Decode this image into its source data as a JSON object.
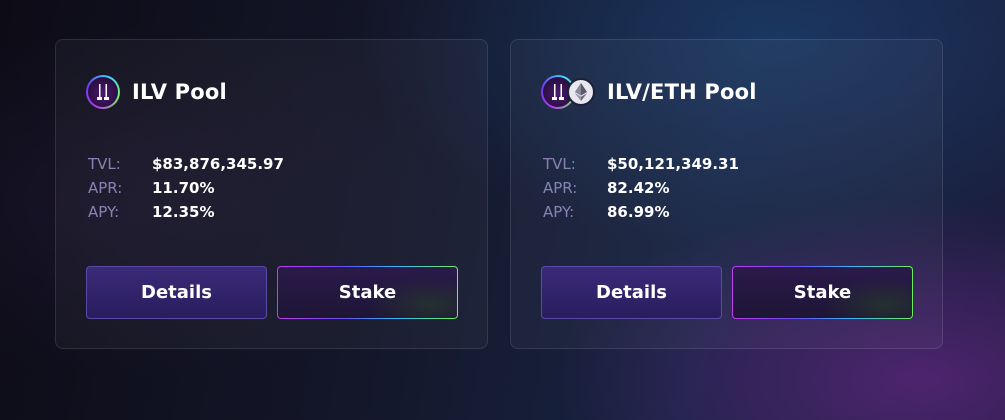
{
  "pools": [
    {
      "title": "ILV Pool",
      "icons": [
        "ilv-icon"
      ],
      "stats": {
        "tvl_label": "TVL:",
        "tvl_value": "$83,876,345.97",
        "apr_label": "APR:",
        "apr_value": "11.70%",
        "apy_label": "APY:",
        "apy_value": "12.35%"
      },
      "buttons": {
        "details_label": "Details",
        "stake_label": "Stake"
      }
    },
    {
      "title": "ILV/ETH Pool",
      "icons": [
        "ilv-icon",
        "eth-icon"
      ],
      "stats": {
        "tvl_label": "TVL:",
        "tvl_value": "$50,121,349.31",
        "apr_label": "APR:",
        "apr_value": "82.42%",
        "apy_label": "APY:",
        "apy_value": "86.99%"
      },
      "buttons": {
        "details_label": "Details",
        "stake_label": "Stake"
      }
    }
  ],
  "colors": {
    "label": "#8883b4",
    "details_button": "#2f2268",
    "stake_border_gradient": [
      "#c03cf0",
      "#6a4cf0",
      "#3cb4ff",
      "#6cf05a"
    ]
  }
}
